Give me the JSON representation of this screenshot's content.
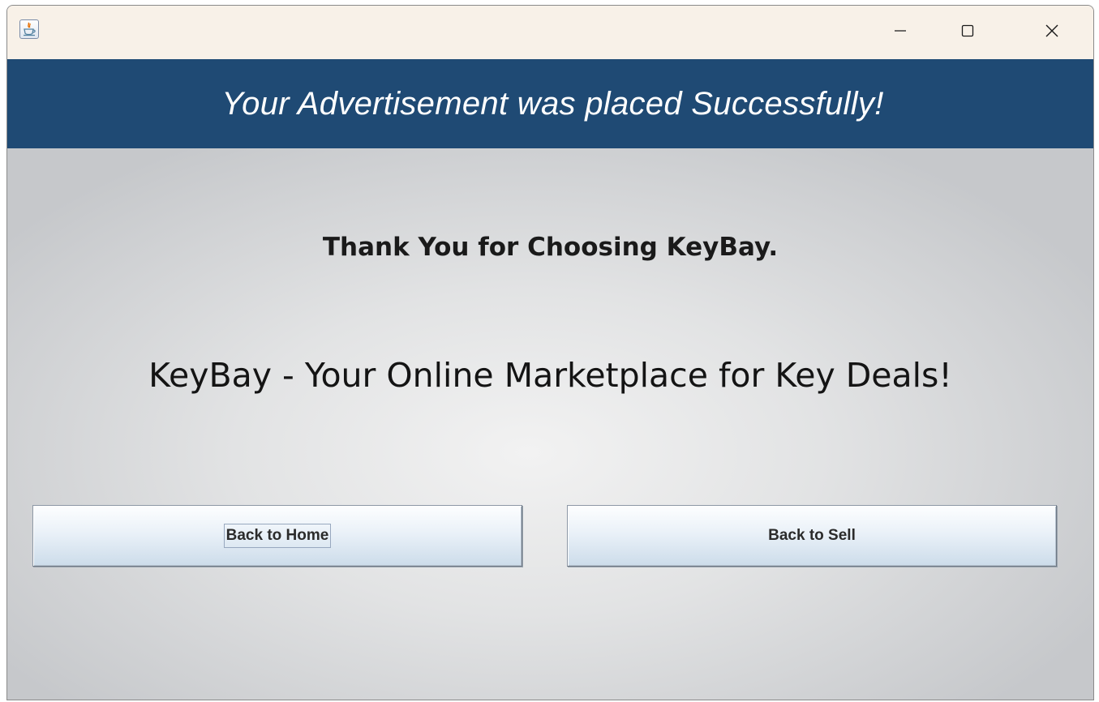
{
  "window": {
    "title": "",
    "controls": {
      "minimize": "minimize-icon",
      "maximize": "maximize-icon",
      "close": "close-icon"
    }
  },
  "banner": {
    "text": "Your Advertisement was placed Successfully!",
    "background": "#1F4A74",
    "color": "#FFFFFF"
  },
  "main": {
    "thanks": "Thank You for Choosing KeyBay.",
    "tagline": "KeyBay - Your Online Marketplace for Key Deals!"
  },
  "buttons": {
    "home_label": "Back to Home",
    "sell_label": "Back to Sell"
  }
}
